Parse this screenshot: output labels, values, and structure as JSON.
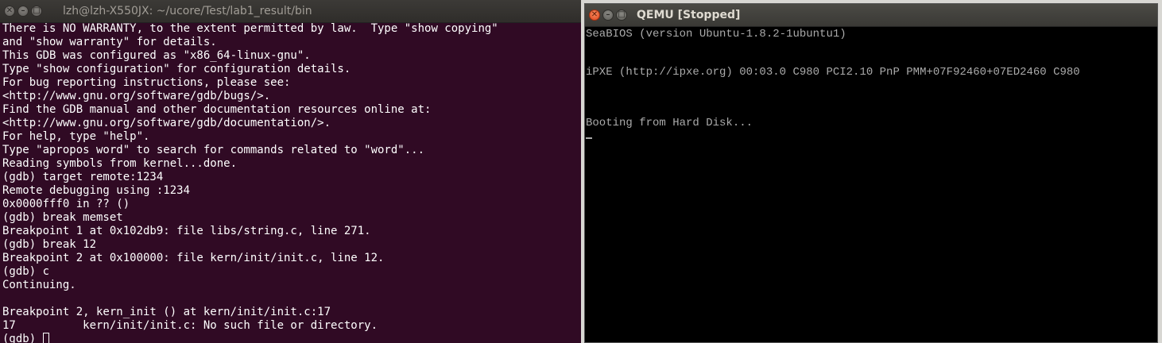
{
  "terminal": {
    "title": "lzh@lzh-X550JX: ~/ucore/Test/lab1_result/bin",
    "lines": [
      "There is NO WARRANTY, to the extent permitted by law.  Type \"show copying\"",
      "and \"show warranty\" for details.",
      "This GDB was configured as \"x86_64-linux-gnu\".",
      "Type \"show configuration\" for configuration details.",
      "For bug reporting instructions, please see:",
      "<http://www.gnu.org/software/gdb/bugs/>.",
      "Find the GDB manual and other documentation resources online at:",
      "<http://www.gnu.org/software/gdb/documentation/>.",
      "For help, type \"help\".",
      "Type \"apropos word\" to search for commands related to \"word\"...",
      "Reading symbols from kernel...done.",
      "(gdb) target remote:1234",
      "Remote debugging using :1234",
      "0x0000fff0 in ?? ()",
      "(gdb) break memset",
      "Breakpoint 1 at 0x102db9: file libs/string.c, line 271.",
      "(gdb) break 12",
      "Breakpoint 2 at 0x100000: file kern/init/init.c, line 12.",
      "(gdb) c",
      "Continuing.",
      "",
      "Breakpoint 2, kern_init () at kern/init/init.c:17",
      "17\t    kern/init/init.c: No such file or directory."
    ],
    "prompt": "(gdb) "
  },
  "qemu": {
    "title": "QEMU [Stopped]",
    "lines": [
      "SeaBIOS (version Ubuntu-1.8.2-1ubuntu1)",
      "",
      "",
      "iPXE (http://ipxe.org) 00:03.0 C980 PCI2.10 PnP PMM+07F92460+07ED2460 C980",
      "",
      "",
      "",
      "Booting from Hard Disk..."
    ]
  },
  "window_buttons": {
    "close_glyph": "✕",
    "minimize_glyph": "–",
    "maximize_glyph": "□"
  },
  "colors": {
    "terminal_bg": "#300a24",
    "qemu_bg": "#000000",
    "close_accent": "#e0481e"
  }
}
